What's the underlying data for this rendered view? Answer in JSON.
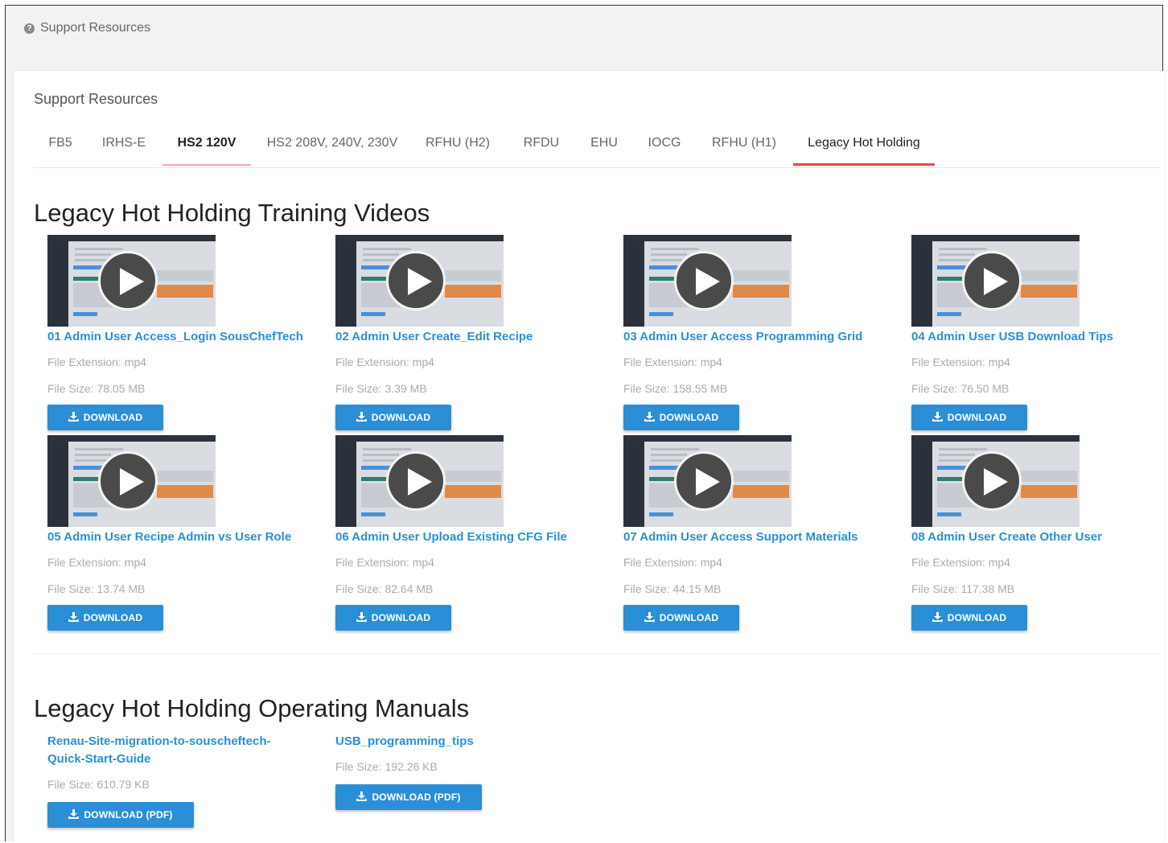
{
  "breadcrumb": {
    "label": "Support Resources"
  },
  "panel": {
    "title": "Support Resources"
  },
  "tabs": [
    {
      "label": "FB5"
    },
    {
      "label": "IRHS-E"
    },
    {
      "label": "HS2 120V"
    },
    {
      "label": "HS2 208V, 240V, 230V"
    },
    {
      "label": "RFHU (H2)"
    },
    {
      "label": "RFDU"
    },
    {
      "label": "EHU"
    },
    {
      "label": "IOCG"
    },
    {
      "label": "RFHU (H1)"
    },
    {
      "label": "Legacy Hot Holding"
    }
  ],
  "videos": {
    "title": "Legacy Hot Holding Training Videos",
    "items": [
      {
        "title": "01 Admin User Access_Login SousChefTech",
        "ext": "File Extension: mp4",
        "size": "File Size: 78.05 MB",
        "button": "DOWNLOAD"
      },
      {
        "title": "02 Admin User Create_Edit Recipe",
        "ext": "File Extension: mp4",
        "size": "File Size: 3.39 MB",
        "button": "DOWNLOAD"
      },
      {
        "title": "03 Admin User Access Programming Grid",
        "ext": "File Extension: mp4",
        "size": "File Size: 158.55 MB",
        "button": "DOWNLOAD"
      },
      {
        "title": "04 Admin User USB Download Tips",
        "ext": "File Extension: mp4",
        "size": "File Size: 76.50 MB",
        "button": "DOWNLOAD"
      },
      {
        "title": "05 Admin User Recipe Admin vs User Role",
        "ext": "File Extension: mp4",
        "size": "File Size: 13.74 MB",
        "button": "DOWNLOAD"
      },
      {
        "title": "06 Admin User Upload Existing CFG File",
        "ext": "File Extension: mp4",
        "size": "File Size: 82.64 MB",
        "button": "DOWNLOAD"
      },
      {
        "title": "07 Admin User Access Support Materials",
        "ext": "File Extension: mp4",
        "size": "File Size: 44.15 MB",
        "button": "DOWNLOAD"
      },
      {
        "title": "08 Admin User Create Other User",
        "ext": "File Extension: mp4",
        "size": "File Size: 117.38 MB",
        "button": "DOWNLOAD"
      }
    ]
  },
  "manuals": {
    "title": "Legacy Hot Holding Operating Manuals",
    "items": [
      {
        "title_line1": "Renau-Site-migration-to-souscheftech-",
        "title_line2": "Quick-Start-Guide",
        "size": "File Size: 610.79 KB",
        "button": "DOWNLOAD (PDF)"
      },
      {
        "title_line1": "USB_programming_tips",
        "title_line2": "",
        "size": "File Size: 192.26 KB",
        "button": "DOWNLOAD (PDF)"
      }
    ]
  },
  "colors": {
    "accent": "#2a8fd6",
    "active_tab_underline": "#e8474f",
    "tab_underline_light": "#f2a8b0"
  }
}
